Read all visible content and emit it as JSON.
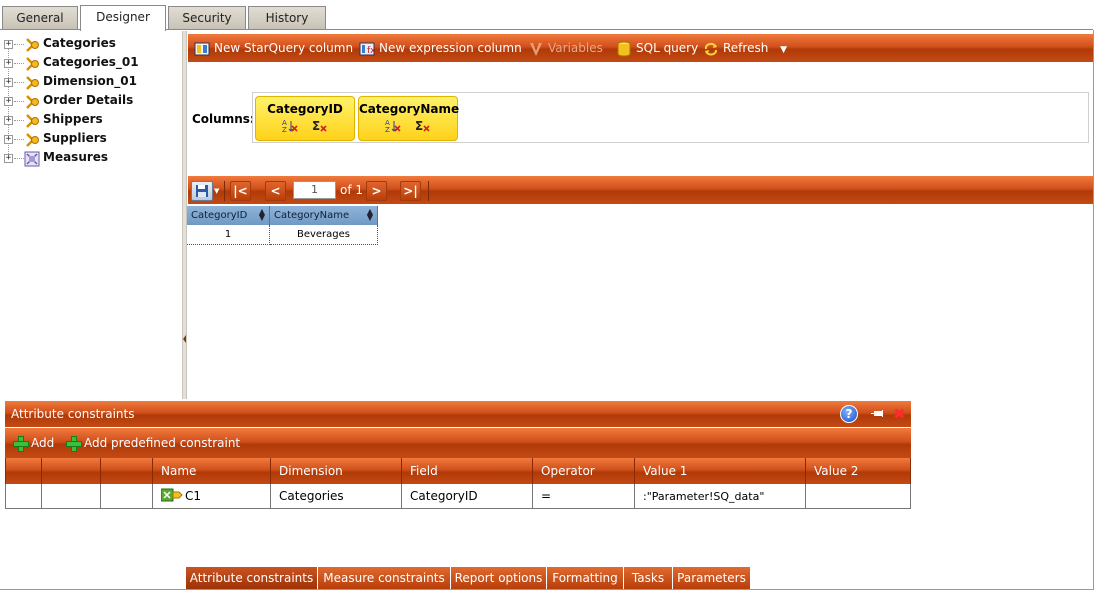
{
  "top_tabs": [
    "General",
    "Designer",
    "Security",
    "History"
  ],
  "tree": [
    {
      "label": "Categories",
      "expander": "+",
      "icon": "dimension-icon"
    },
    {
      "label": "Categories_01",
      "expander": "+",
      "icon": "dimension-icon"
    },
    {
      "label": "Dimension_01",
      "expander": "+",
      "icon": "dimension-icon"
    },
    {
      "label": "Order Details",
      "expander": "+",
      "icon": "dimension-icon"
    },
    {
      "label": "Shippers",
      "expander": "+",
      "icon": "dimension-icon"
    },
    {
      "label": "Suppliers",
      "expander": "+",
      "icon": "dimension-icon"
    },
    {
      "label": "Measures",
      "expander": "+",
      "icon": "measures-icon"
    }
  ],
  "toolbar": {
    "new_starquery": "New StarQuery column",
    "new_expression": "New expression column",
    "variables": "Variables",
    "sql_query": "SQL query",
    "refresh": "Refresh"
  },
  "columns": {
    "label": "Columns:",
    "items": [
      "CategoryID",
      "CategoryName"
    ]
  },
  "pager": {
    "page_value": "1",
    "of_label": "of 1"
  },
  "grid": {
    "headers": [
      "CategoryID",
      "CategoryName"
    ],
    "rows": [
      [
        "1",
        "Beverages"
      ]
    ]
  },
  "attribute_constraints": {
    "title": "Attribute constraints",
    "add": "Add",
    "add_predefined": "Add predefined constraint",
    "headers": [
      "Name",
      "Dimension",
      "Field",
      "Operator",
      "Value 1",
      "Value 2"
    ],
    "rows": [
      {
        "name": "C1",
        "dimension": "Categories",
        "field": "CategoryID",
        "operator": "=",
        "value1": ":\"Parameter!SQ_data\"",
        "value2": ""
      }
    ]
  },
  "bottom_tabs": [
    "Attribute constraints",
    "Measure constraints",
    "Report options",
    "Formatting",
    "Tasks",
    "Parameters"
  ],
  "colors": {
    "accent": "#c84a14",
    "grid_header": "#7fa6ce",
    "pill": "#ffe03a"
  }
}
